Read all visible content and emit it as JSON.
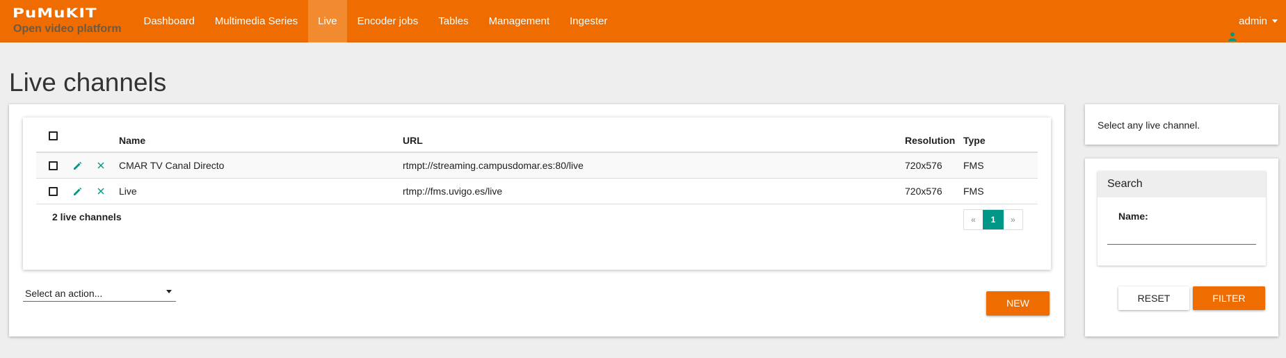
{
  "brand": {
    "logo_text": "PuMuKIT",
    "tagline": "Open video platform"
  },
  "nav": {
    "items": [
      {
        "label": "Dashboard"
      },
      {
        "label": "Multimedia Series"
      },
      {
        "label": "Live"
      },
      {
        "label": "Encoder jobs"
      },
      {
        "label": "Tables"
      },
      {
        "label": "Management"
      },
      {
        "label": "Ingester"
      }
    ],
    "active": "Live",
    "user": {
      "name": "admin",
      "icon": "user-icon"
    }
  },
  "page": {
    "title": "Live channels"
  },
  "table": {
    "columns": {
      "name": "Name",
      "url": "URL",
      "resolution": "Resolution",
      "type": "Type"
    },
    "rows": [
      {
        "name": "CMAR TV Canal Directo",
        "url": "rtmpt://streaming.campusdomar.es:80/live",
        "resolution": "720x576",
        "type": "FMS"
      },
      {
        "name": "Live",
        "url": "rtmp://fms.uvigo.es/live",
        "resolution": "720x576",
        "type": "FMS"
      }
    ],
    "row_actions": {
      "edit_icon": "pencil-icon",
      "delete_icon": "close-icon"
    },
    "count_text": "2 live channels",
    "pagination": {
      "prev": "«",
      "current": "1",
      "next": "»"
    }
  },
  "actions": {
    "select_placeholder": "Select an action...",
    "new_label": "NEW"
  },
  "sidebar": {
    "info_text": "Select any live channel.",
    "search": {
      "title": "Search",
      "name_label": "Name:",
      "name_value": "",
      "reset_label": "RESET",
      "filter_label": "FILTER"
    }
  },
  "colors": {
    "brand": "#ef6c00",
    "accent": "#009688",
    "background": "#eeeeee"
  }
}
